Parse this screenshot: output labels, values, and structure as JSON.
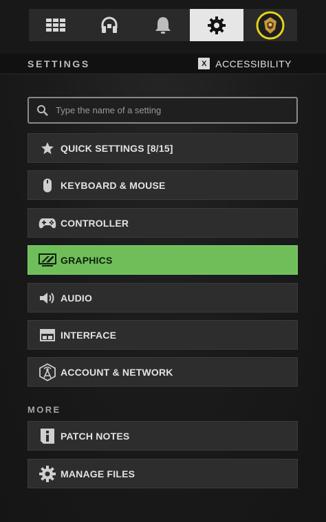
{
  "tabs": [
    {
      "icon": "grid-icon",
      "active": false
    },
    {
      "icon": "headset-icon",
      "active": false
    },
    {
      "icon": "bell-icon",
      "active": false
    },
    {
      "icon": "gear-icon",
      "active": true
    },
    {
      "icon": "profile-avatar-icon",
      "active": false
    }
  ],
  "header": {
    "title": "SETTINGS",
    "accessibility_key": "X",
    "accessibility_label": "ACCESSIBILITY"
  },
  "search": {
    "placeholder": "Type the name of a setting",
    "value": ""
  },
  "menu": [
    {
      "label": "QUICK SETTINGS [8/15]",
      "icon": "star-icon",
      "selected": false
    },
    {
      "label": "KEYBOARD & MOUSE",
      "icon": "mouse-icon",
      "selected": false
    },
    {
      "label": "CONTROLLER",
      "icon": "gamepad-icon",
      "selected": false
    },
    {
      "label": "GRAPHICS",
      "icon": "monitor-icon",
      "selected": true
    },
    {
      "label": "AUDIO",
      "icon": "speaker-icon",
      "selected": false
    },
    {
      "label": "INTERFACE",
      "icon": "interface-icon",
      "selected": false
    },
    {
      "label": "ACCOUNT & NETWORK",
      "icon": "network-icon",
      "selected": false
    }
  ],
  "more": {
    "title": "MORE",
    "items": [
      {
        "label": "PATCH NOTES",
        "icon": "info-icon"
      },
      {
        "label": "MANAGE FILES",
        "icon": "cog-icon"
      }
    ]
  },
  "colors": {
    "accent": "#6fbe5a",
    "avatar_ring": "#e4d41c",
    "background": "#1a1a1a"
  }
}
